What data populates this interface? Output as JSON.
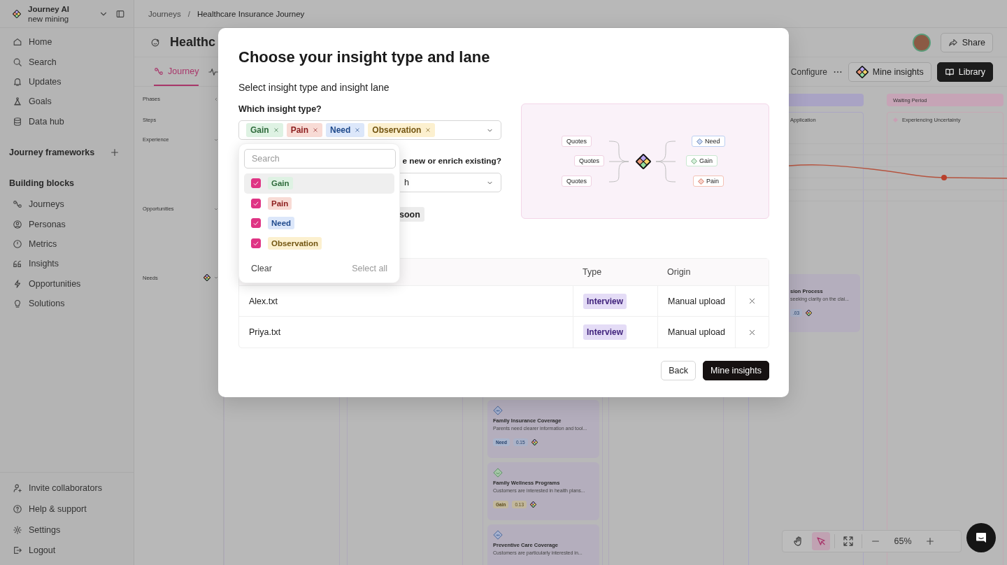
{
  "sidebar": {
    "workspace": {
      "name": "Journey AI",
      "subtitle": "new mining"
    },
    "nav": [
      {
        "label": "Home"
      },
      {
        "label": "Search"
      },
      {
        "label": "Updates"
      },
      {
        "label": "Goals"
      },
      {
        "label": "Data hub"
      }
    ],
    "frameworks_title": "Journey frameworks",
    "blocks_title": "Building blocks",
    "blocks": [
      {
        "label": "Journeys"
      },
      {
        "label": "Personas"
      },
      {
        "label": "Metrics"
      },
      {
        "label": "Insights"
      },
      {
        "label": "Opportunities"
      },
      {
        "label": "Solutions"
      }
    ],
    "footer": [
      {
        "label": "Invite collaborators"
      },
      {
        "label": "Help & support"
      },
      {
        "label": "Settings"
      },
      {
        "label": "Logout"
      }
    ]
  },
  "breadcrumb": [
    "Journeys",
    "Healthcare Insurance Journey"
  ],
  "breadcrumb_separator": "/",
  "header": {
    "title": "Healthc",
    "share": "Share"
  },
  "tabs": [
    {
      "label": "Journey",
      "selected": true
    }
  ],
  "toolbar": {
    "configure": "Configure",
    "mine_insights": "Mine insights",
    "library": "Library"
  },
  "lanes": [
    {
      "label": "Phases",
      "kind": "left"
    },
    {
      "label": "Steps",
      "kind": "plain"
    },
    {
      "label": "Experience",
      "kind": "down"
    },
    {
      "label": "Opportunities",
      "kind": "down"
    },
    {
      "label": "Needs",
      "kind": "logo"
    }
  ],
  "canvas": {
    "phases": [
      {
        "color": "#a9a3c4"
      },
      {
        "label": "Waiting Period",
        "color": "#c6a4b6"
      }
    ],
    "steps": [
      {
        "label": "Application",
        "marker": false
      },
      {
        "label": "Experiencing Uncertainty",
        "marker": true
      }
    ],
    "side_card": {
      "title": "sion Process",
      "text": "seeking clarity on the clai...",
      "score": ".03"
    },
    "cards": [
      {
        "kind": "need",
        "title": "Family Insurance Coverage",
        "text": "Parents need clearer information and tool...",
        "tag": "Need",
        "score": "0.15"
      },
      {
        "kind": "gain",
        "title": "Family Wellness Programs",
        "text": "Customers are interested in health plans...",
        "tag": "Gain",
        "score": "0.13"
      },
      {
        "kind": "need",
        "title": "Preventive Care Coverage",
        "text": "Customers are particularly interested in..."
      }
    ]
  },
  "zoom_bar": {
    "tools": [
      {
        "kind": "hand",
        "selected": false
      },
      {
        "kind": "pointer",
        "selected": true
      },
      {
        "kind": "fit",
        "selected": false
      }
    ],
    "level": "65%"
  },
  "modal": {
    "title": "Choose your insight type and lane",
    "subtitle": "Select insight type and insight lane",
    "type_label": "Which insight type?",
    "selected_types": [
      {
        "label": "Gain",
        "kind": "gain"
      },
      {
        "label": "Pain",
        "kind": "pain"
      },
      {
        "label": "Need",
        "kind": "need"
      },
      {
        "label": "Observation",
        "kind": "observation"
      }
    ],
    "mode_label": "e new or enrich existing?",
    "mode_value": "h",
    "soon_badge": "soon",
    "illustration": {
      "sources": [
        "Quotes",
        "Quotes",
        "Quotes"
      ],
      "outputs": [
        {
          "label": "Need",
          "kind": "need"
        },
        {
          "label": "Gain",
          "kind": "gain"
        },
        {
          "label": "Pain",
          "kind": "pain"
        }
      ]
    },
    "table": {
      "columns": [
        "Type",
        "Origin"
      ],
      "rows": [
        {
          "name": "Alex.txt",
          "type": "Interview",
          "origin": "Manual upload"
        },
        {
          "name": "Priya.txt",
          "type": "Interview",
          "origin": "Manual upload"
        }
      ]
    },
    "buttons": {
      "back": "Back",
      "confirm": "Mine insights"
    },
    "dropdown": {
      "placeholder": "Search",
      "options": [
        {
          "label": "Gain",
          "kind": "gain",
          "checked": true,
          "highlighted": true
        },
        {
          "label": "Pain",
          "kind": "pain",
          "checked": true,
          "highlighted": false
        },
        {
          "label": "Need",
          "kind": "need",
          "checked": true,
          "highlighted": false
        },
        {
          "label": "Observation",
          "kind": "observation",
          "checked": true,
          "highlighted": false
        }
      ],
      "clear": "Clear",
      "select_all": "Select all"
    }
  }
}
